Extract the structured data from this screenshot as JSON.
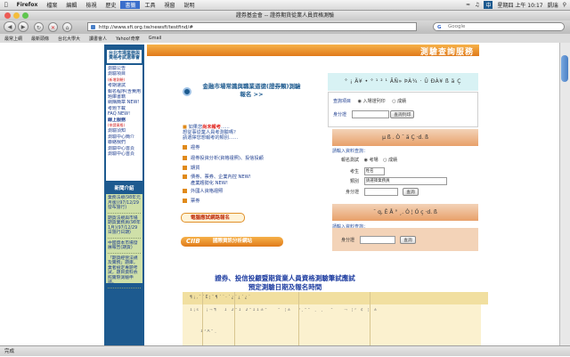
{
  "menubar": {
    "app": "Firefox",
    "items": [
      "檔案",
      "編輯",
      "檢視",
      "歷史",
      "書籤",
      "工具",
      "視窗",
      "說明"
    ],
    "clock": "星期四 上午 10:17",
    "user": "凱瑞"
  },
  "window": {
    "title": "證券基金會 -- 證券期貨從業人員資格測驗"
  },
  "toolbar": {
    "url": "http://www.sfi.org.tw/newsfi/testfind/#",
    "search_placeholder": "Google"
  },
  "bookmarks": [
    "最常上網",
    "最新頭條",
    "台北大學大",
    "讀書會人",
    "Yahoo!奇摩",
    "Gmail"
  ],
  "sidebar": {
    "title": "台北市場業務與資格考試選舉會",
    "menu": [
      "測驗公告",
      "測驗項目",
      "(新增測驗)",
      "考期速試",
      "報名程序(含費用)",
      "題庫書籍",
      "網購簡章 NEW!",
      "考題下載",
      "FAQ NEW!",
      "線上服務",
      "(申請資格)",
      "測驗須知",
      "測驗中心簡介",
      "聯絡我們",
      "測驗中心首頁",
      "測驗中心首頁"
    ],
    "news_header": "新聞介紹",
    "news": [
      "業務法規(98年元月版)(97/12/29發布施行)",
      "期貨法規與市場期貨業務員(98年1月)(97/12/29日施行日期)",
      "中國資本市場發展報告(期貨)",
      "「期貨經營法規及實務」題庫，業者檢定專題考試，題目資料依照實際測驗申請。"
    ]
  },
  "header": {
    "title": "測驗查詢服務"
  },
  "promo": {
    "text": "金融市場常識與職業道德(證券類)測驗報名 >>"
  },
  "notice": {
    "lead": "如果您",
    "highlight": "尚未報考",
    "rest": "......",
    "line2": "想從事從業人員考測驗嗎？",
    "line3": "請選擇您想報考的類別……"
  },
  "exam_links": [
    "證券",
    "證券投資分析(資格證照)、投信投顧",
    "期貨",
    "債券、票券、企業內控 NEW!",
    "產業趨勢化 NEW!",
    "外國人資格證照",
    "票券"
  ],
  "buttons": {
    "online_apply": "電腦應試網路報名",
    "ciib_brand": "CIIB",
    "ciib_label": "國際資訊分析網站"
  },
  "query_panel": {
    "header": "° ¡ Ä¥ • ° ¹ ² ¹ ÃÑ» ÞÀ¾ · Û ÐÀ¥ ß ä Ç",
    "row1_label": "查詢項目",
    "opt_entry": "入場證列印",
    "opt_score": "成績",
    "row2_label": "身分證",
    "print_btn": "查詢列印"
  },
  "entry_panel": {
    "header": "µ ß . Ò ¯ ä Ç ·d. ß",
    "sub": "請輸入資料查詢：",
    "exam_label": "報名測試",
    "opt_exam": "考場",
    "opt_score": "成績",
    "year_label": "考生",
    "year_value": "姓名",
    "type_label": "類別",
    "type_value": "請選擇業務員",
    "id_label": "身分證",
    "query_btn": "查詢"
  },
  "score_panel": {
    "header": "¯ q, Ê Å ° ¸. Ò ¦ Ó ç ·d. ß",
    "sub": "請輸入資料查詢：",
    "id_label": "身分證",
    "query_btn": "查詢"
  },
  "headline": {
    "line1": "證券、投信投顧暨期貨業人員資格測驗筆試應試",
    "line2": "預定測驗日期及報名時間"
  },
  "table": {
    "header": "¶ ¡ , ¨ ´ Ë ¦ ¨ ¶ ´ ´ · ´ ¿ ´ ¿ ´ ¿ ´",
    "row1": "1 ¡ s ¨ ´ ¡ ¬ ¶ ´ ´ 1 ¯ 2 ° 1 ´ 2 ° 1 1 ± ° ¨ ´ ´ ° ¯ ¦ ± ´ ´ ³ ¸ ° ° ´ ¸ ´ ¸ ´ ¯ ° ¯ ´ ´ ¬ ¯ ¦ ³ ´ ¢ ¯ ¦ ´ ±",
    "row2": "1 ³ Á ° ¸"
  },
  "status": "完成"
}
